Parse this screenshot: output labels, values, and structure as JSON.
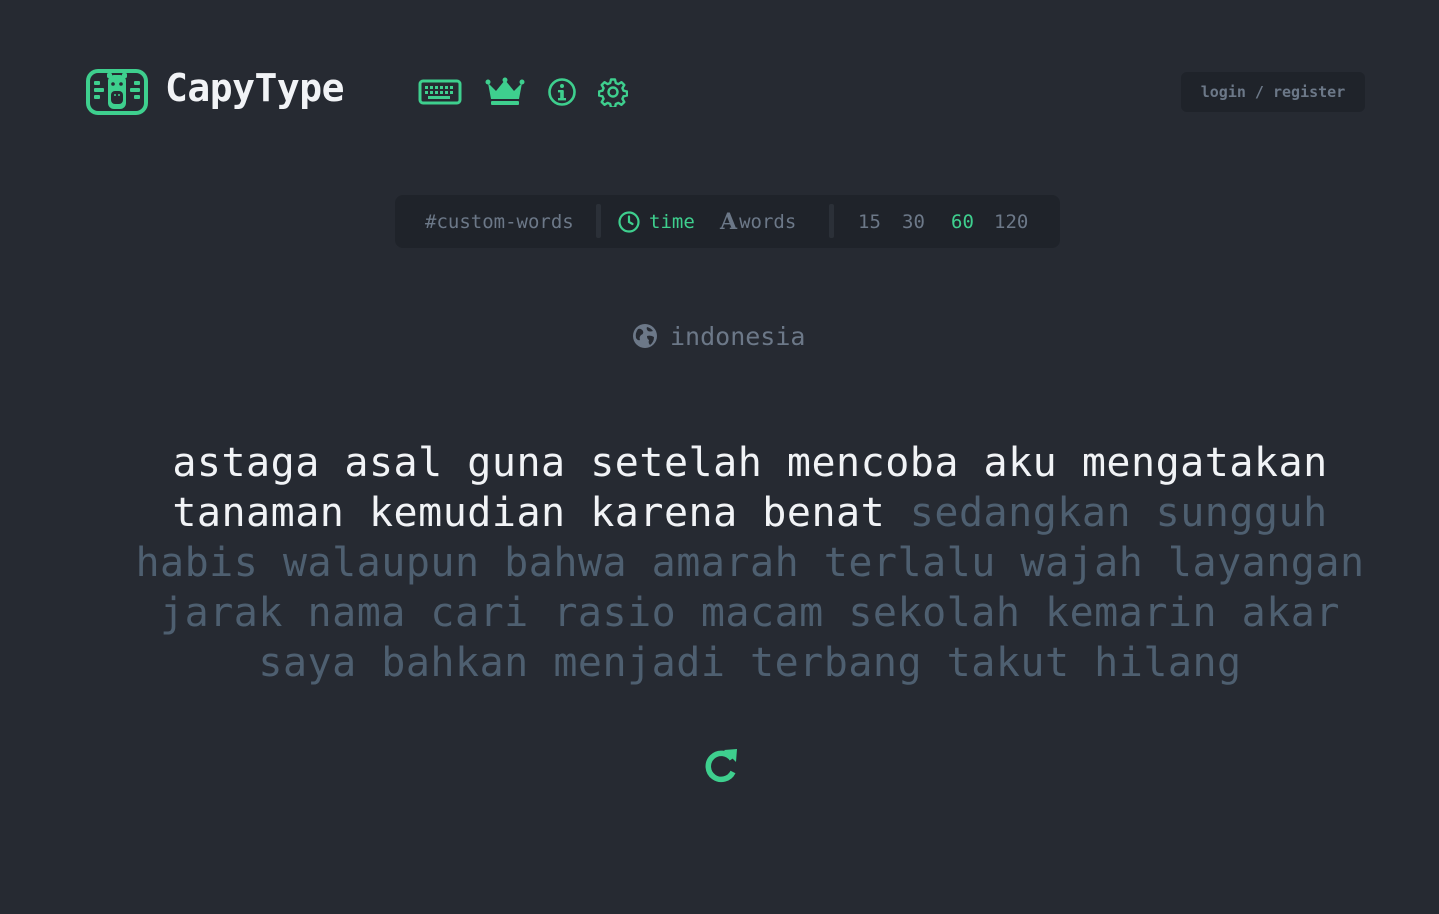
{
  "header": {
    "brand": "CapyType",
    "nav_icons": [
      "keyboard-icon",
      "crown-icon",
      "info-icon",
      "settings-icon"
    ],
    "login_label": "login / register"
  },
  "config": {
    "custom_words": "#custom-words",
    "time_label": "time",
    "words_glyph": "A",
    "words_label": "words",
    "durations": [
      "15",
      "30",
      "60",
      "120"
    ],
    "selected_mode": "time",
    "selected_duration": "60"
  },
  "language": {
    "icon": "globe-icon",
    "label": "indonesia"
  },
  "test": {
    "lines": [
      {
        "typed": "astaga asal guna setelah mencoba aku mengatakan",
        "untyped": ""
      },
      {
        "typed": "tanaman kemudian karena benat",
        "untyped": " sedangkan sungguh"
      },
      {
        "typed": "",
        "untyped": "habis walaupun bahwa amarah terlalu wajah layangan"
      },
      {
        "typed": "",
        "untyped": "jarak nama cari rasio macam sekolah kemarin akar"
      },
      {
        "typed": "",
        "untyped": "saya bahkan menjadi terbang takut hilang"
      }
    ]
  },
  "restart": {
    "icon": "restart-icon"
  },
  "colors": {
    "background": "#262a32",
    "panel": "#1f232a",
    "accent": "#3ecf8e",
    "text_typed": "#f1f3f6",
    "text_untyped": "#4e5f70",
    "muted": "#6c7888"
  }
}
